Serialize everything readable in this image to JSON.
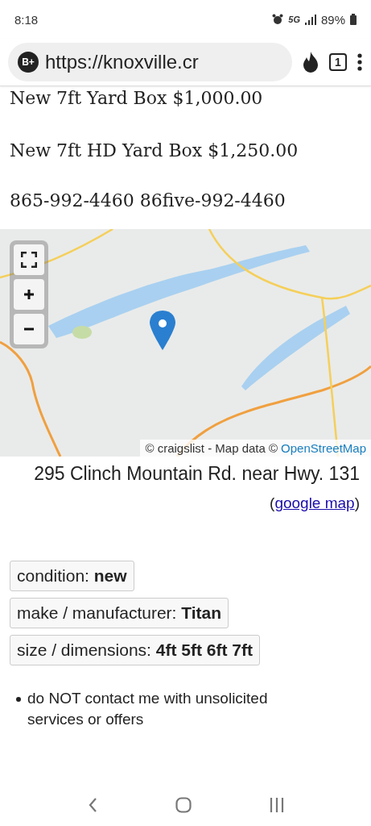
{
  "status_bar": {
    "time": "8:18",
    "network": "5G",
    "battery": "89%"
  },
  "browser": {
    "badge": "B+",
    "url": "https://knoxville.cr",
    "tab_count": "1"
  },
  "price_lines": [
    "New 7ft Yard Box $1,000.00",
    "New 7ft HD Yard Box $1,250.00",
    "865-992-4460 86five-992-4460"
  ],
  "map": {
    "attribution": "© craigslist - Map data ©",
    "attribution_link": "OpenStreetMap"
  },
  "address": "295 Clinch Mountain Rd. near Hwy. 131",
  "map_link": {
    "open": "(",
    "label": "google map",
    "close": ")"
  },
  "attributes": [
    "condition: **new**",
    "make / manufacturer: **Titan**",
    "size / dimensions: **4ft 5ft 6ft 7ft**"
  ],
  "notices": [
    "do NOT contact me with unsolicited services or offers"
  ]
}
